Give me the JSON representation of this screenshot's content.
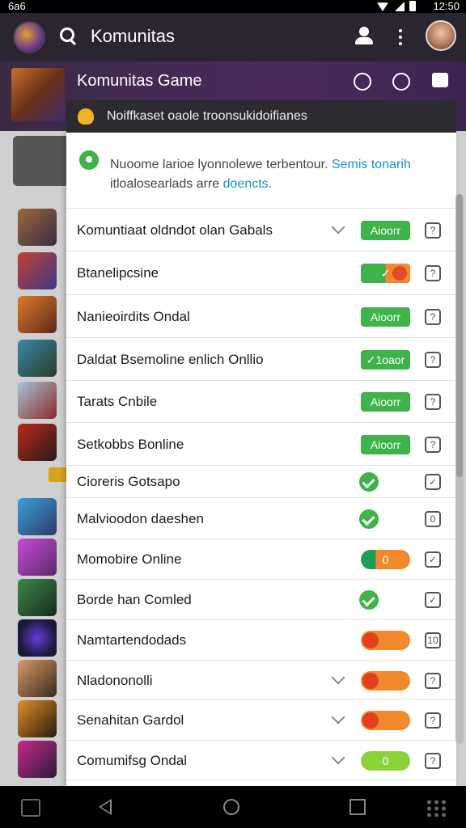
{
  "status_bar": {
    "time_left": "6a6",
    "time_right": "12:50"
  },
  "app_bar": {
    "title": "Komunitas"
  },
  "game_header": {
    "title": "Komunitas Game"
  },
  "notification": {
    "text": "Noiffkaset oaole troonsukidoifianes"
  },
  "message": {
    "text_main": "Nuoome larioe lyonnolewe terbentour.",
    "link1": "Semis tonarih",
    "text_second": "itloalosearlads arre",
    "link2": "doencts."
  },
  "rows": [
    {
      "label": "Komuntiaat oldndot olan Gabals",
      "chevron": true,
      "control": "pill",
      "pill_text": "Aioorr",
      "pill_style": "green",
      "qbox": "?"
    },
    {
      "label": "Btanelipcsine",
      "chevron": false,
      "control": "pill",
      "pill_text": "✓",
      "pill_style": "toggle-go",
      "qbox": "?"
    },
    {
      "label": "Nanieoirdits Ondal",
      "chevron": false,
      "control": "pill",
      "pill_text": "Aioorr",
      "pill_style": "green",
      "qbox": "?"
    },
    {
      "label": "Daldat Bsemoline enlich Onllio",
      "chevron": false,
      "control": "pill",
      "pill_text": "✓1oaor",
      "pill_style": "green",
      "qbox": "?"
    },
    {
      "label": "Tarats Cnbile",
      "chevron": false,
      "control": "pill",
      "pill_text": "Aioorr",
      "pill_style": "green",
      "qbox": "?"
    },
    {
      "label": "Setkobbs Bonline",
      "chevron": false,
      "control": "pill",
      "pill_text": "Aioorr",
      "pill_style": "green",
      "qbox": "?"
    },
    {
      "label": "Cioreris Gotsapo",
      "chevron": false,
      "control": "check",
      "qbox": "✓"
    },
    {
      "label": "Malvioodon daeshen",
      "chevron": false,
      "control": "check",
      "qbox": "0"
    },
    {
      "label": "Momobire Online",
      "chevron": false,
      "control": "pill",
      "pill_text": "0",
      "pill_style": "green-orange",
      "qbox": "✓"
    },
    {
      "label": "Borde han Comled",
      "chevron": false,
      "control": "check",
      "qbox": "✓"
    },
    {
      "label": "Namtartendodads",
      "chevron": false,
      "control": "pill",
      "pill_text": "",
      "pill_style": "orange",
      "qbox": "10"
    },
    {
      "label": "Nladononolli",
      "chevron": true,
      "control": "pill",
      "pill_text": "",
      "pill_style": "orange",
      "qbox": "?"
    },
    {
      "label": "Senahitan Gardol",
      "chevron": true,
      "control": "pill",
      "pill_text": "",
      "pill_style": "orange",
      "qbox": "?"
    },
    {
      "label": "Comumifsg Ondal",
      "chevron": true,
      "control": "pill",
      "pill_text": "0",
      "pill_style": "lime",
      "qbox": "?"
    }
  ],
  "icons": {
    "search": "search-icon",
    "person": "person-icon",
    "more": "more-vert-icon",
    "back": "back-icon",
    "home": "home-icon",
    "recent": "recent-apps-icon"
  },
  "colors": {
    "accent_green": "#3db34a",
    "accent_orange": "#f08a2c",
    "link_blue": "#1a8fc9",
    "header_purple": "#4a2a5c"
  }
}
